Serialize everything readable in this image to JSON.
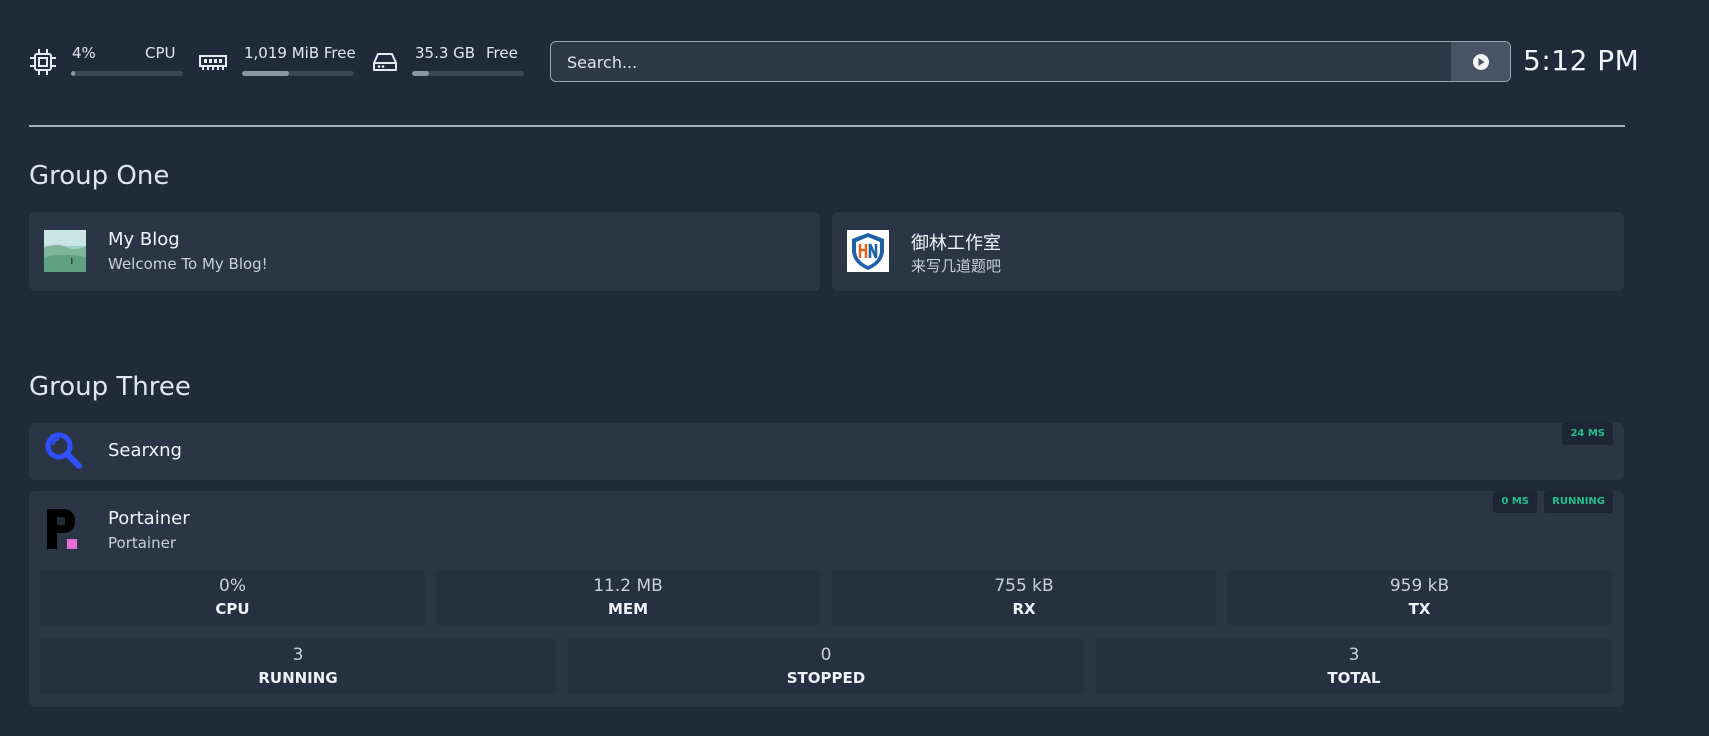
{
  "header": {
    "resources": {
      "cpu": {
        "value": "4%",
        "label": "CPU",
        "usage": 0.04,
        "icon": "cpu-chip-icon"
      },
      "memory": {
        "value": "1,019 MiB Free",
        "usage": 0.42,
        "icon": "memory-icon"
      },
      "disk": {
        "value": "35.3 GB",
        "label": "Free",
        "usage": 0.15,
        "icon": "hard-drive-icon"
      }
    },
    "search": {
      "placeholder": "Search...",
      "button_icon": "search-engine-icon"
    },
    "clock": "5:12 PM"
  },
  "groups": [
    {
      "title": "Group One",
      "services": [
        {
          "name": "My Blog",
          "description": "Welcome To My Blog!",
          "icon": "blog-landscape-icon"
        },
        {
          "name": "御林工作室",
          "description": "来写几道题吧",
          "icon": "shield-logo-icon"
        }
      ]
    },
    {
      "title": "Group Three",
      "services": [
        {
          "name": "Searxng",
          "description": "",
          "icon": "magnifier-icon",
          "ping": "24 MS"
        },
        {
          "name": "Portainer",
          "description": "Portainer",
          "icon": "portainer-logo-icon",
          "ping": "0 MS",
          "status": "RUNNING",
          "stats_row1": [
            {
              "value": "0%",
              "label": "CPU"
            },
            {
              "value": "11.2 MB",
              "label": "MEM"
            },
            {
              "value": "755 kB",
              "label": "RX"
            },
            {
              "value": "959 kB",
              "label": "TX"
            }
          ],
          "stats_row2": [
            {
              "value": "3",
              "label": "RUNNING"
            },
            {
              "value": "0",
              "label": "STOPPED"
            },
            {
              "value": "3",
              "label": "TOTAL"
            }
          ]
        }
      ]
    }
  ],
  "colors": {
    "background": "#1f2a3b",
    "card": "#2a3546",
    "status_green": "#22c08a"
  }
}
